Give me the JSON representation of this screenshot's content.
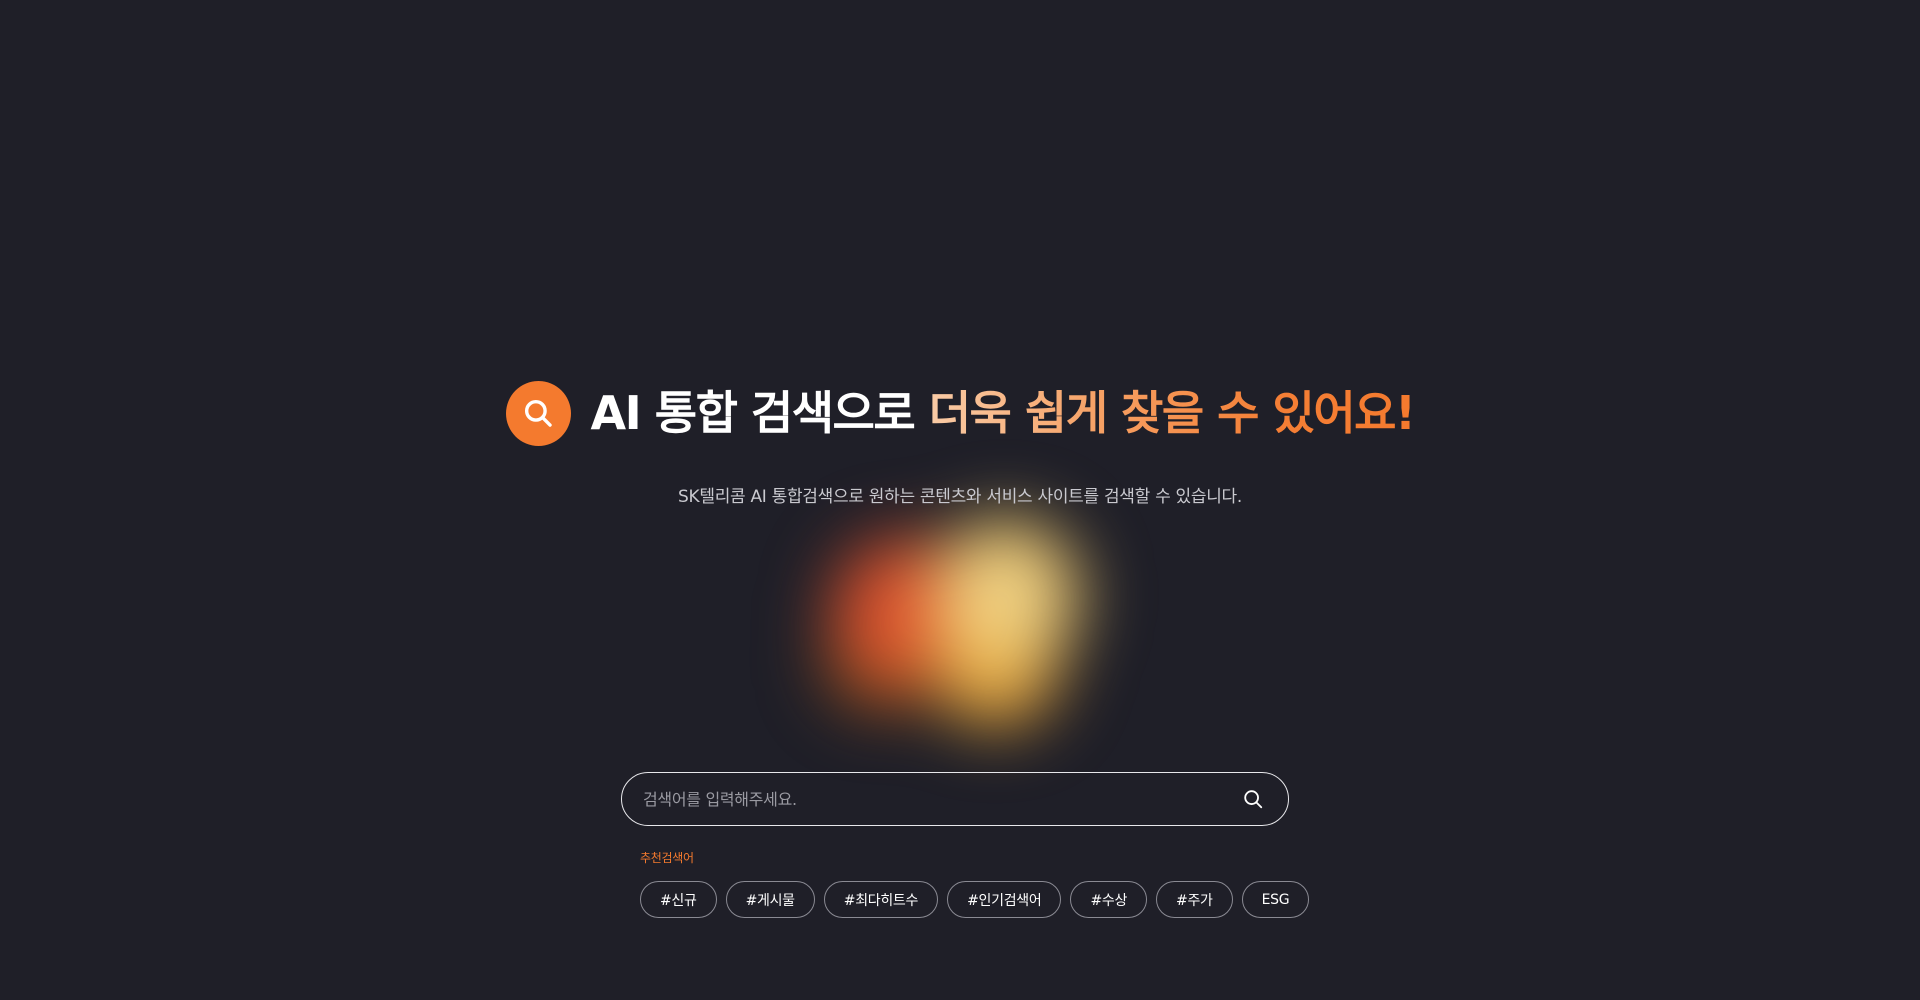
{
  "hero": {
    "title_white": "AI 통합 검색으로",
    "title_accent": "더욱 쉽게 찾을 수 있어요!",
    "subtitle": "SK텔리콤 AI 통합검색으로 원하는 콘텐츠와 서비스 사이트를 검색할 수 있습니다.",
    "icon": "search-icon"
  },
  "search": {
    "placeholder": "검색어를 입력해주세요.",
    "value": "",
    "button_icon": "search-icon"
  },
  "recommended": {
    "label": "추천검색어",
    "keywords": [
      "#신규",
      "#게시물",
      "#최다히트수",
      "#인기검색어",
      "#수상",
      "#주가",
      "ESG"
    ]
  },
  "colors": {
    "background": "#1f1f28",
    "accent": "#f47a2e",
    "accent_light": "#f9cba6"
  }
}
